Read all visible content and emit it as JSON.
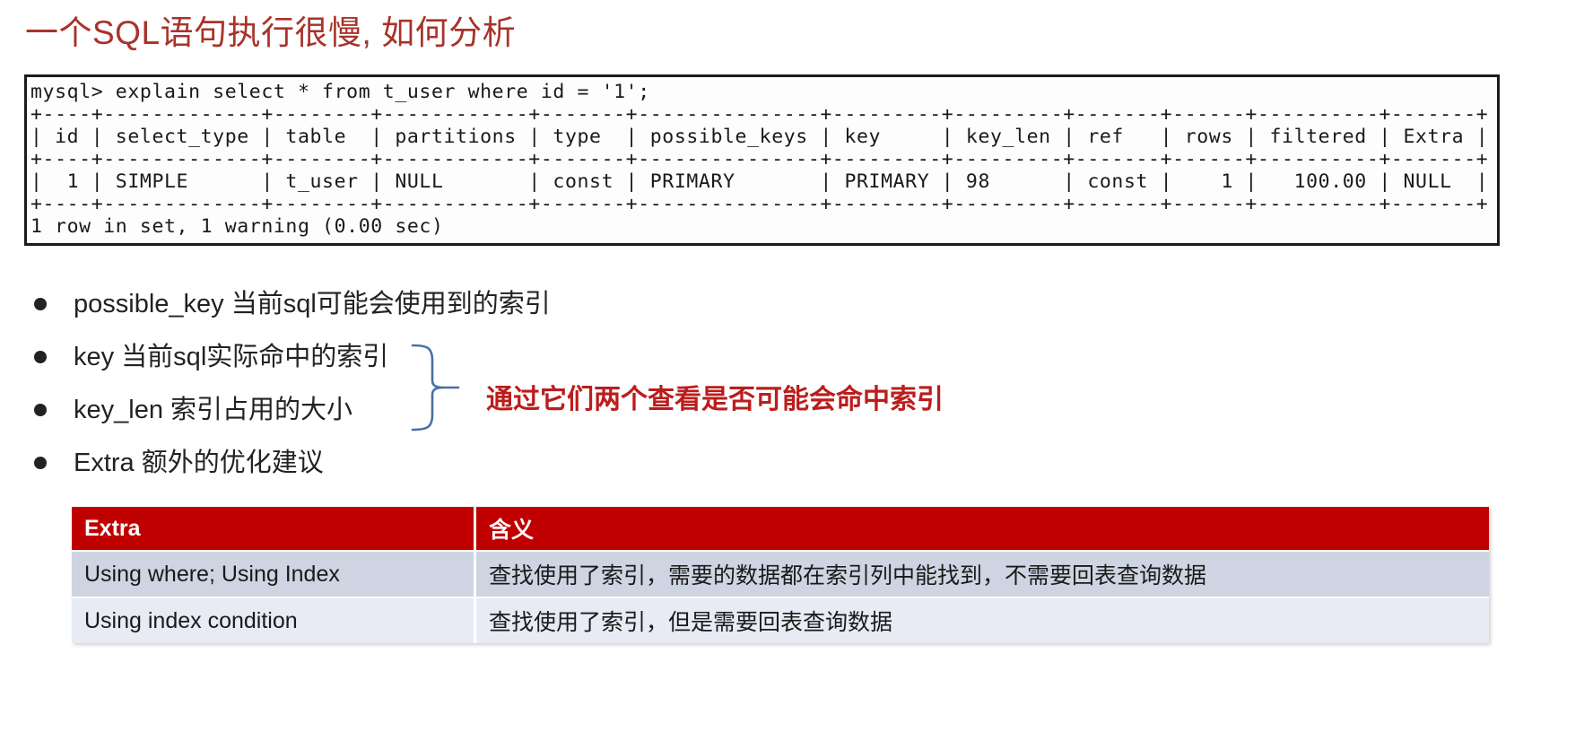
{
  "slide": {
    "title": "一个SQL语句执行很慢, 如何分析",
    "title_color": "#a8332a"
  },
  "terminal": {
    "name": "mysql-explain-output",
    "prompt_line": "mysql> explain select * from t_user where id = '1';",
    "columns": [
      "id",
      "select_type",
      "table",
      "partitions",
      "type",
      "possible_keys",
      "key",
      "key_len",
      "ref",
      "rows",
      "filtered",
      "Extra"
    ],
    "rows": [
      {
        "id": "1",
        "select_type": "SIMPLE",
        "table": "t_user",
        "partitions": "NULL",
        "type": "const",
        "possible_keys": "PRIMARY",
        "key": "PRIMARY",
        "key_len": "98",
        "ref": "const",
        "rows": "1",
        "filtered": "100.00",
        "Extra": "NULL"
      }
    ],
    "footer_line": "1 row in set, 1 warning (0.00 sec)",
    "raw": "mysql> explain select * from t_user where id = '1';\n+----+-------------+--------+------------+-------+---------------+---------+---------+-------+------+----------+-------+\n| id | select_type | table  | partitions | type  | possible_keys | key     | key_len | ref   | rows | filtered | Extra |\n+----+-------------+--------+------------+-------+---------------+---------+---------+-------+------+----------+-------+\n|  1 | SIMPLE      | t_user | NULL       | const | PRIMARY       | PRIMARY | 98      | const |    1 |   100.00 | NULL  |\n+----+-------------+--------+------------+-------+---------------+---------+---------+-------+------+----------+-------+\n1 row in set, 1 warning (0.00 sec)"
  },
  "bullets": [
    {
      "text": "possible_key  当前sql可能会使用到的索引"
    },
    {
      "text": "key 当前sql实际命中的索引"
    },
    {
      "text": "key_len 索引占用的大小"
    },
    {
      "text": "Extra 额外的优化建议"
    }
  ],
  "annotation": {
    "text": "通过它们两个查看是否可能会命中索引",
    "color": "#bb1d1d",
    "brace_color": "#4a6fa5"
  },
  "extra_table": {
    "headers": [
      "Extra",
      "含义"
    ],
    "header_bg": "#c00000",
    "rows": [
      {
        "extra": "Using where; Using Index",
        "meaning": "查找使用了索引，需要的数据都在索引列中能找到，不需要回表查询数据"
      },
      {
        "extra": "Using index condition",
        "meaning": "查找使用了索引，但是需要回表查询数据"
      }
    ]
  }
}
